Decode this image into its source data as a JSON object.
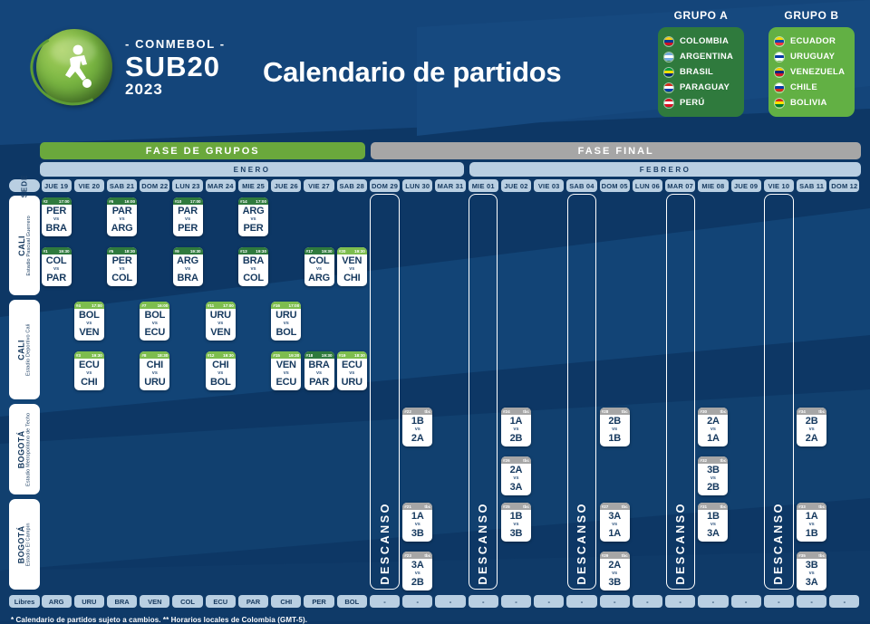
{
  "logo": {
    "conmebol": "- CONMEBOL -",
    "sub20": "SUB20",
    "year": "2023"
  },
  "header": {
    "title": "Calendario de partidos"
  },
  "groups": [
    {
      "title": "GRUPO A",
      "color": "#2f7a3d",
      "teams": [
        {
          "name": "COLOMBIA",
          "flag": [
            "#fcd116",
            "#003893",
            "#ce1126"
          ]
        },
        {
          "name": "ARGENTINA",
          "flag": [
            "#74acdf",
            "#ffffff",
            "#74acdf"
          ]
        },
        {
          "name": "BRASIL",
          "flag": [
            "#009c3b",
            "#ffdf00",
            "#002776"
          ]
        },
        {
          "name": "PARAGUAY",
          "flag": [
            "#d52b1e",
            "#ffffff",
            "#0038a8"
          ]
        },
        {
          "name": "PERÚ",
          "flag": [
            "#d91023",
            "#ffffff",
            "#d91023"
          ]
        }
      ]
    },
    {
      "title": "GRUPO B",
      "color": "#62b044",
      "teams": [
        {
          "name": "ECUADOR",
          "flag": [
            "#ffdd00",
            "#0047ab",
            "#ef3340"
          ]
        },
        {
          "name": "URUGUAY",
          "flag": [
            "#ffffff",
            "#0038a8",
            "#ffffff"
          ]
        },
        {
          "name": "VENEZUELA",
          "flag": [
            "#ffcc00",
            "#00247d",
            "#cf142b"
          ]
        },
        {
          "name": "CHILE",
          "flag": [
            "#ffffff",
            "#0039a6",
            "#d52b1e"
          ]
        },
        {
          "name": "BOLIVIA",
          "flag": [
            "#d52b1e",
            "#f9e300",
            "#007a33"
          ]
        }
      ]
    }
  ],
  "sede_label": "SEDE",
  "phases": [
    {
      "label": "FASE DE GRUPOS",
      "color": "#6aa83c"
    },
    {
      "label": "FASE FINAL",
      "color": "#a6a6a6"
    }
  ],
  "months": [
    {
      "label": "ENERO"
    },
    {
      "label": "FEBRERO"
    }
  ],
  "dates": [
    "JUE 19",
    "VIE 20",
    "SAB 21",
    "DOM 22",
    "LUN 23",
    "MAR 24",
    "MIE 25",
    "JUE 26",
    "VIE 27",
    "SAB 28",
    "DOM 29",
    "LUN 30",
    "MAR 31",
    "MIE 01",
    "JUE 02",
    "VIE 03",
    "SAB 04",
    "DOM 05",
    "LUN 06",
    "MAR 07",
    "MIE 08",
    "JUE 09",
    "VIE 10",
    "SAB 11",
    "DOM 12"
  ],
  "venues": [
    {
      "city": "CALI",
      "stadium": "Estadio Pascual Guerrero"
    },
    {
      "city": "CALI",
      "stadium": "Estadio Deportivo Cali"
    },
    {
      "city": "BOGOTÁ",
      "stadium": "Estadio Metropolitano de Techo"
    },
    {
      "city": "BOGOTÁ",
      "stadium": "Estadio El Campín"
    }
  ],
  "vs_label": "vs",
  "tbd_label": "tbc",
  "descanso_label": "DESCANSO",
  "descanso_columns": [
    10,
    13,
    16,
    19,
    22
  ],
  "matches": [
    {
      "id": "#2",
      "time": "17:00",
      "group": "gA",
      "venue": 0,
      "col": 0,
      "slot": 0,
      "home": "PER",
      "away": "BRA"
    },
    {
      "id": "#1",
      "time": "19:30",
      "group": "gA",
      "venue": 0,
      "col": 0,
      "slot": 1,
      "home": "COL",
      "away": "PAR"
    },
    {
      "id": "#6",
      "time": "16:00",
      "group": "gA",
      "venue": 0,
      "col": 2,
      "slot": 0,
      "home": "PAR",
      "away": "ARG"
    },
    {
      "id": "#5",
      "time": "18:30",
      "group": "gA",
      "venue": 0,
      "col": 2,
      "slot": 1,
      "home": "PER",
      "away": "COL"
    },
    {
      "id": "#10",
      "time": "17:00",
      "group": "gA",
      "venue": 0,
      "col": 4,
      "slot": 0,
      "home": "PAR",
      "away": "PER"
    },
    {
      "id": "#9",
      "time": "19:30",
      "group": "gA",
      "venue": 0,
      "col": 4,
      "slot": 1,
      "home": "ARG",
      "away": "BRA"
    },
    {
      "id": "#14",
      "time": "17:00",
      "group": "gA",
      "venue": 0,
      "col": 6,
      "slot": 0,
      "home": "ARG",
      "away": "PER"
    },
    {
      "id": "#13",
      "time": "19:30",
      "group": "gA",
      "venue": 0,
      "col": 6,
      "slot": 1,
      "home": "BRA",
      "away": "COL"
    },
    {
      "id": "#17",
      "time": "19:30",
      "group": "gA",
      "venue": 0,
      "col": 8,
      "slot": 1,
      "home": "COL",
      "away": "ARG"
    },
    {
      "id": "#20",
      "time": "19:30",
      "group": "gB",
      "venue": 0,
      "col": 9,
      "slot": 1,
      "home": "VEN",
      "away": "CHI"
    },
    {
      "id": "#4",
      "time": "17:00",
      "group": "gB",
      "venue": 1,
      "col": 1,
      "slot": 0,
      "home": "BOL",
      "away": "VEN"
    },
    {
      "id": "#3",
      "time": "19:30",
      "group": "gB",
      "venue": 1,
      "col": 1,
      "slot": 1,
      "home": "ECU",
      "away": "CHI"
    },
    {
      "id": "#7",
      "time": "16:00",
      "group": "gB",
      "venue": 1,
      "col": 3,
      "slot": 0,
      "home": "BOL",
      "away": "ECU"
    },
    {
      "id": "#8",
      "time": "18:30",
      "group": "gB",
      "venue": 1,
      "col": 3,
      "slot": 1,
      "home": "CHI",
      "away": "URU"
    },
    {
      "id": "#11",
      "time": "17:00",
      "group": "gB",
      "venue": 1,
      "col": 5,
      "slot": 0,
      "home": "URU",
      "away": "VEN"
    },
    {
      "id": "#12",
      "time": "19:30",
      "group": "gB",
      "venue": 1,
      "col": 5,
      "slot": 1,
      "home": "CHI",
      "away": "BOL"
    },
    {
      "id": "#16",
      "time": "17:00",
      "group": "gB",
      "venue": 1,
      "col": 7,
      "slot": 0,
      "home": "URU",
      "away": "BOL"
    },
    {
      "id": "#15",
      "time": "19:30",
      "group": "gB",
      "venue": 1,
      "col": 7,
      "slot": 1,
      "home": "VEN",
      "away": "ECU"
    },
    {
      "id": "#18",
      "time": "19:30",
      "group": "gA",
      "venue": 1,
      "col": 8,
      "slot": 1,
      "home": "BRA",
      "away": "PAR"
    },
    {
      "id": "#19",
      "time": "18:30",
      "group": "gB",
      "venue": 1,
      "col": 9,
      "slot": 1,
      "home": "ECU",
      "away": "URU"
    },
    {
      "id": "#22",
      "time": "tbc",
      "group": "gF",
      "venue": 2,
      "col": 11,
      "slot": 0,
      "home": "1B",
      "away": "2A"
    },
    {
      "id": "#24",
      "time": "tbc",
      "group": "gF",
      "venue": 2,
      "col": 14,
      "slot": 0,
      "home": "1A",
      "away": "2B"
    },
    {
      "id": "#26",
      "time": "tbc",
      "group": "gF",
      "venue": 2,
      "col": 14,
      "slot": 1,
      "home": "2A",
      "away": "3A"
    },
    {
      "id": "#28",
      "time": "tbc",
      "group": "gF",
      "venue": 2,
      "col": 17,
      "slot": 0,
      "home": "2B",
      "away": "1B"
    },
    {
      "id": "#30",
      "time": "tbc",
      "group": "gF",
      "venue": 2,
      "col": 20,
      "slot": 0,
      "home": "2A",
      "away": "1A"
    },
    {
      "id": "#32",
      "time": "tbc",
      "group": "gF",
      "venue": 2,
      "col": 20,
      "slot": 1,
      "home": "3B",
      "away": "2B"
    },
    {
      "id": "#34",
      "time": "tbc",
      "group": "gF",
      "venue": 2,
      "col": 23,
      "slot": 0,
      "home": "2B",
      "away": "2A"
    },
    {
      "id": "#21",
      "time": "tbc",
      "group": "gF",
      "venue": 3,
      "col": 11,
      "slot": 0,
      "home": "1A",
      "away": "3B"
    },
    {
      "id": "#23",
      "time": "tbc",
      "group": "gF",
      "venue": 3,
      "col": 11,
      "slot": 1,
      "home": "3A",
      "away": "2B"
    },
    {
      "id": "#25",
      "time": "tbc",
      "group": "gF",
      "venue": 3,
      "col": 14,
      "slot": 0,
      "home": "1B",
      "away": "3B"
    },
    {
      "id": "#27",
      "time": "tbc",
      "group": "gF",
      "venue": 3,
      "col": 17,
      "slot": 0,
      "home": "3A",
      "away": "1A"
    },
    {
      "id": "#29",
      "time": "tbc",
      "group": "gF",
      "venue": 3,
      "col": 17,
      "slot": 1,
      "home": "2A",
      "away": "3B"
    },
    {
      "id": "#31",
      "time": "tbc",
      "group": "gF",
      "venue": 3,
      "col": 20,
      "slot": 0,
      "home": "1B",
      "away": "3A"
    },
    {
      "id": "#33",
      "time": "tbc",
      "group": "gF",
      "venue": 3,
      "col": 23,
      "slot": 0,
      "home": "1A",
      "away": "1B"
    },
    {
      "id": "#35",
      "time": "tbc",
      "group": "gF",
      "venue": 3,
      "col": 23,
      "slot": 1,
      "home": "3B",
      "away": "3A"
    }
  ],
  "libres": {
    "tag": "Libres",
    "values": [
      "ARG",
      "URU",
      "BRA",
      "VEN",
      "COL",
      "ECU",
      "PAR",
      "CHI",
      "PER",
      "BOL",
      "-",
      "-",
      "-",
      "-",
      "-",
      "-",
      "-",
      "-",
      "-",
      "-",
      "-",
      "-",
      "-",
      "-",
      "-"
    ]
  },
  "footnote": "* Calendario de partidos sujeto a cambios. ** Horarios locales de Colombia (GMT-5)."
}
